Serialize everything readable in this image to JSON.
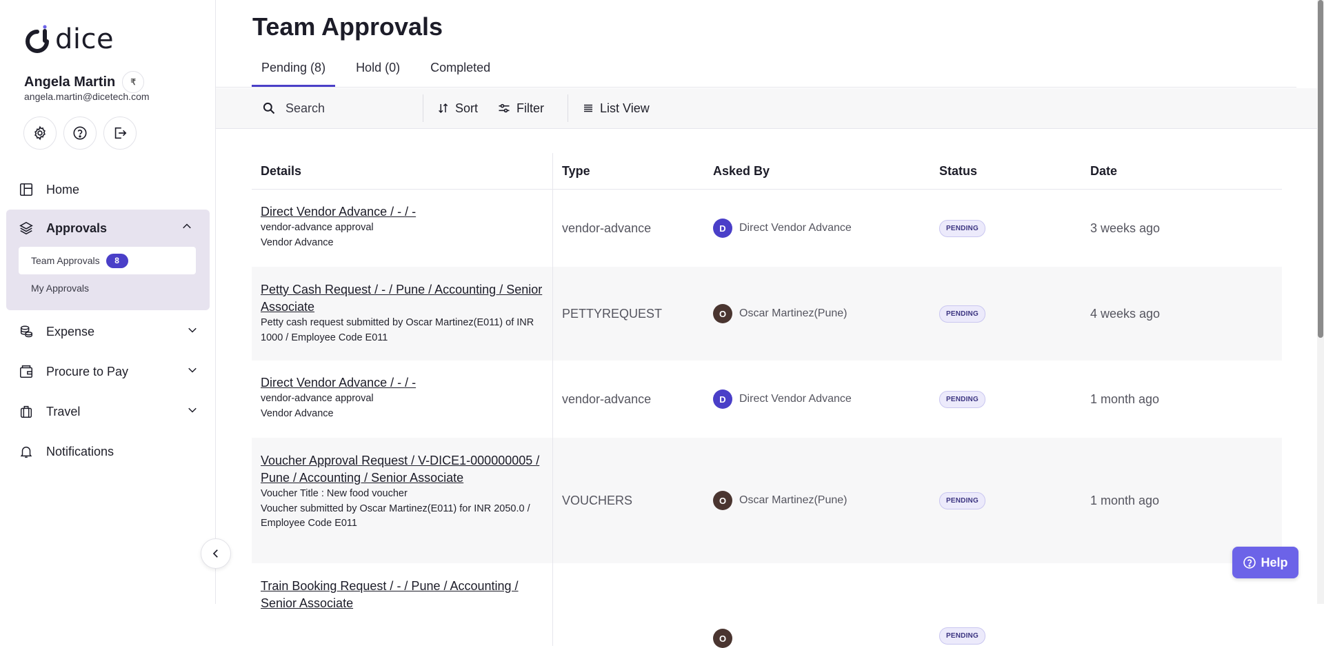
{
  "brand": {
    "name": "dice"
  },
  "user": {
    "name": "Angela Martin",
    "email": "angela.martin@dicetech.com",
    "currency_symbol": "₹"
  },
  "sidebar": {
    "items": [
      {
        "label": "Home",
        "icon": "home-grid-icon"
      },
      {
        "label": "Approvals",
        "icon": "layers-icon",
        "expanded": true,
        "children": [
          {
            "label": "Team Approvals",
            "count": "8",
            "active": true
          },
          {
            "label": "My Approvals"
          }
        ]
      },
      {
        "label": "Expense",
        "icon": "coins-icon"
      },
      {
        "label": "Procure to Pay",
        "icon": "wallet-icon"
      },
      {
        "label": "Travel",
        "icon": "luggage-icon"
      },
      {
        "label": "Notifications",
        "icon": "bell-icon"
      }
    ]
  },
  "page": {
    "title": "Team Approvals"
  },
  "tabs": [
    {
      "label": "Pending (8)",
      "active": true
    },
    {
      "label": "Hold (0)"
    },
    {
      "label": "Completed"
    }
  ],
  "toolbar": {
    "search_placeholder": "Search",
    "sort_label": "Sort",
    "filter_label": "Filter",
    "view_label": "List View"
  },
  "table": {
    "columns": [
      "Details",
      "Type",
      "Asked By",
      "Status",
      "Date"
    ],
    "rows": [
      {
        "title": "Direct Vendor Advance / -    / -",
        "lines": [
          "vendor-advance approval",
          "Vendor Advance"
        ],
        "type": "vendor-advance",
        "asked_by": "Direct Vendor Advance",
        "avatar_letter": "D",
        "avatar_color": "#4a3fc8",
        "status": "PENDING",
        "date": "3 weeks ago"
      },
      {
        "title": "Petty Cash Request / - / Pune / Accounting / Senior Associate",
        "lines": [
          "Petty cash request submitted by Oscar Martinez(E011) of INR 1000 / Employee Code E011"
        ],
        "type": "PETTYREQUEST",
        "asked_by": "Oscar Martinez(Pune)",
        "avatar_letter": "O",
        "avatar_color": "#4a3530",
        "status": "PENDING",
        "date": "4 weeks ago"
      },
      {
        "title": "Direct Vendor Advance / -    / -",
        "lines": [
          "vendor-advance approval",
          "Vendor Advance"
        ],
        "type": "vendor-advance",
        "asked_by": "Direct Vendor Advance",
        "avatar_letter": "D",
        "avatar_color": "#4a3fc8",
        "status": "PENDING",
        "date": "1 month ago"
      },
      {
        "title": "Voucher Approval Request / V-DICE1-000000005 / Pune / Accounting / Senior Associate",
        "lines": [
          "Voucher Title : New food voucher",
          "Voucher submitted by Oscar Martinez(E011) for INR 2050.0 / Employee Code E011"
        ],
        "type": "VOUCHERS",
        "asked_by": "Oscar Martinez(Pune)",
        "avatar_letter": "O",
        "avatar_color": "#4a3530",
        "status": "PENDING",
        "date": "1 month ago"
      },
      {
        "title": "Train Booking Request / - / Pune / Accounting / Senior Associate",
        "lines": [],
        "type": "",
        "asked_by": "",
        "avatar_letter": "O",
        "avatar_color": "#4a3530",
        "status": "PENDING",
        "date": ""
      }
    ]
  },
  "help": {
    "label": "Help"
  },
  "colors": {
    "accent": "#4a3fc8",
    "help_button": "#6c63e8",
    "approvals_bg": "#e7e3ef"
  }
}
